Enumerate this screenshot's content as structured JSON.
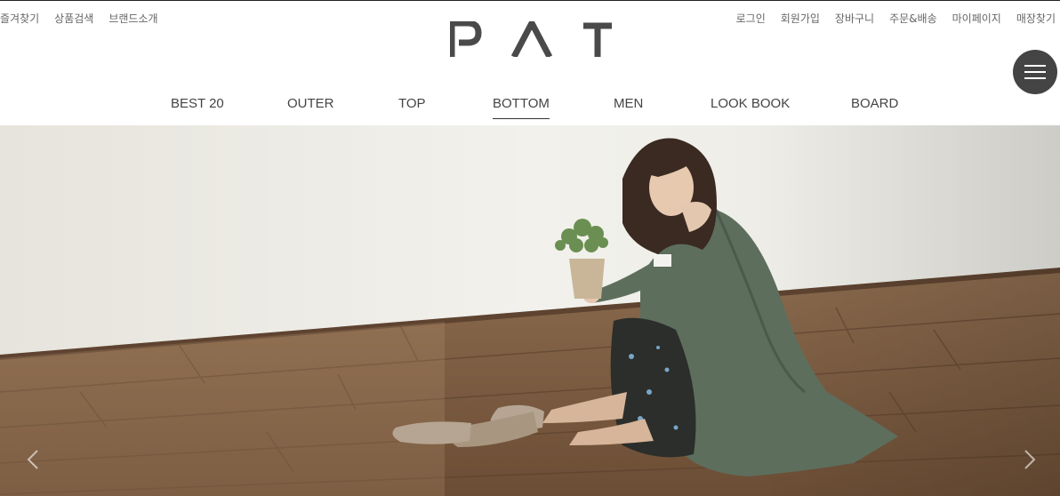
{
  "util_left": [
    "즐겨찾기",
    "상품검색",
    "브랜드소개"
  ],
  "util_right": [
    "로그인",
    "회원가입",
    "장바구니",
    "주문&배송",
    "마이페이지",
    "매장찾기"
  ],
  "logo": {
    "text": "PAT",
    "color": "#4a4a4a"
  },
  "gnb": {
    "items": [
      "BEST 20",
      "OUTER",
      "TOP",
      "BOTTOM",
      "MEN",
      "LOOK BOOK",
      "BOARD"
    ],
    "active": "BOTTOM"
  },
  "colors": {
    "menu_button": "#444444",
    "wall": "#ecebe6",
    "floor": "#7a5a40",
    "coat": "#5d6e5d"
  },
  "icons": {
    "menu": "hamburger-icon",
    "prev": "chevron-left-icon",
    "next": "chevron-right-icon"
  }
}
